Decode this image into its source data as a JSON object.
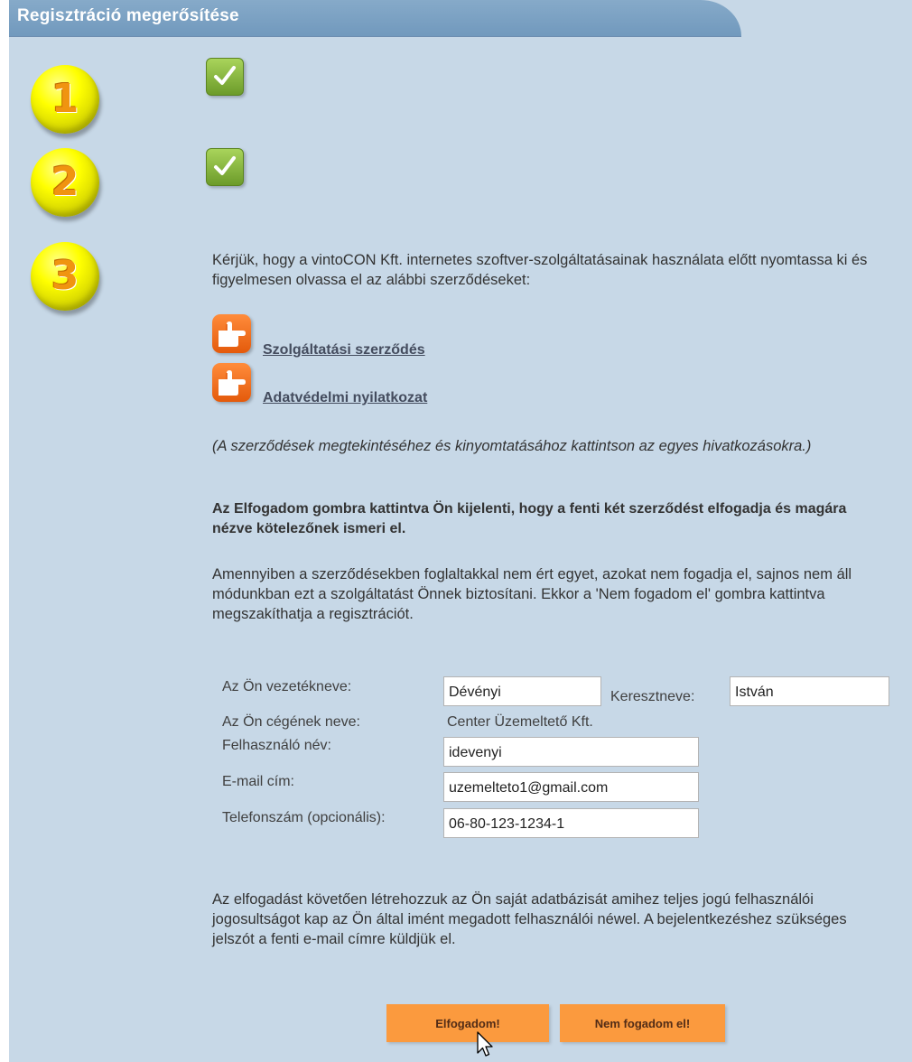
{
  "header": {
    "title": "Regisztráció megerősítése"
  },
  "steps": {
    "step1": "1",
    "step2": "2",
    "step3": "3"
  },
  "intro_text": "Kérjük, hogy a vintoCON Kft. internetes szoftver-szolgáltatásainak használata előtt nyomtassa ki és figyelmesen olvassa el az alábbi szerződéseket:",
  "documents": {
    "service_contract": "Szolgáltatási szerződés",
    "privacy_statement": "Adatvédelmi nyilatkozat"
  },
  "documents_hint": "(A szerződések megtekintéséhez és kinyomtatásához kattintson az egyes hivatkozásokra.)",
  "accept_notice": "Az Elfogadom gombra kattintva Ön kijelenti, hogy a fenti két szerződést elfogadja és magára nézve kötelezőnek ismeri el.",
  "decline_notice": "Amennyiben a szerződésekben foglaltakkal nem ért egyet, azokat nem fogadja el, sajnos nem áll módunkban ezt a szolgáltatást Önnek biztosítani. Ekkor a 'Nem fogadom el' gombra kattintva megszakíthatja a regisztrációt.",
  "form": {
    "last_name_label": "Az Ön vezetékneve:",
    "last_name_value": "Dévényi",
    "first_name_label": "Keresztneve:",
    "first_name_value": "István",
    "company_label": "Az Ön cégének neve:",
    "company_value": "Center Üzemeltető Kft.",
    "username_label": "Felhasználó név:",
    "username_value": "idevenyi",
    "email_label": "E-mail cím:",
    "email_value": "uzemelteto1@gmail.com",
    "phone_label": "Telefonszám (opcionális):",
    "phone_value": "06-80-123-1234-1"
  },
  "footer_text": "Az elfogadást követően létrehozzuk az Ön saját adatbázisát amihez teljes jogú felhasználói jogosultságot kap az Ön által imént megadott felhasználói néwel. A bejelentkezéshez szükséges jelszót a fenti e-mail címre küldjük el.",
  "buttons": {
    "accept": "Elfogadom!",
    "decline": "Nem fogadom el!"
  },
  "icons": {
    "step": "yellow-number-ball",
    "done": "green-check-icon",
    "link": "orange-pointing-hand-icon",
    "cursor": "mouse-pointer-icon"
  },
  "colors": {
    "panel_background": "#c7d8e7",
    "header_background": "#7c9fc4",
    "step_ball": "#ffff00",
    "step_number": "#f09410",
    "check_box": "#8dbb45",
    "hand_icon": "#f0712a",
    "button": "#fb9a3e",
    "button_text": "#522c16",
    "link_text": "#444c5e"
  }
}
